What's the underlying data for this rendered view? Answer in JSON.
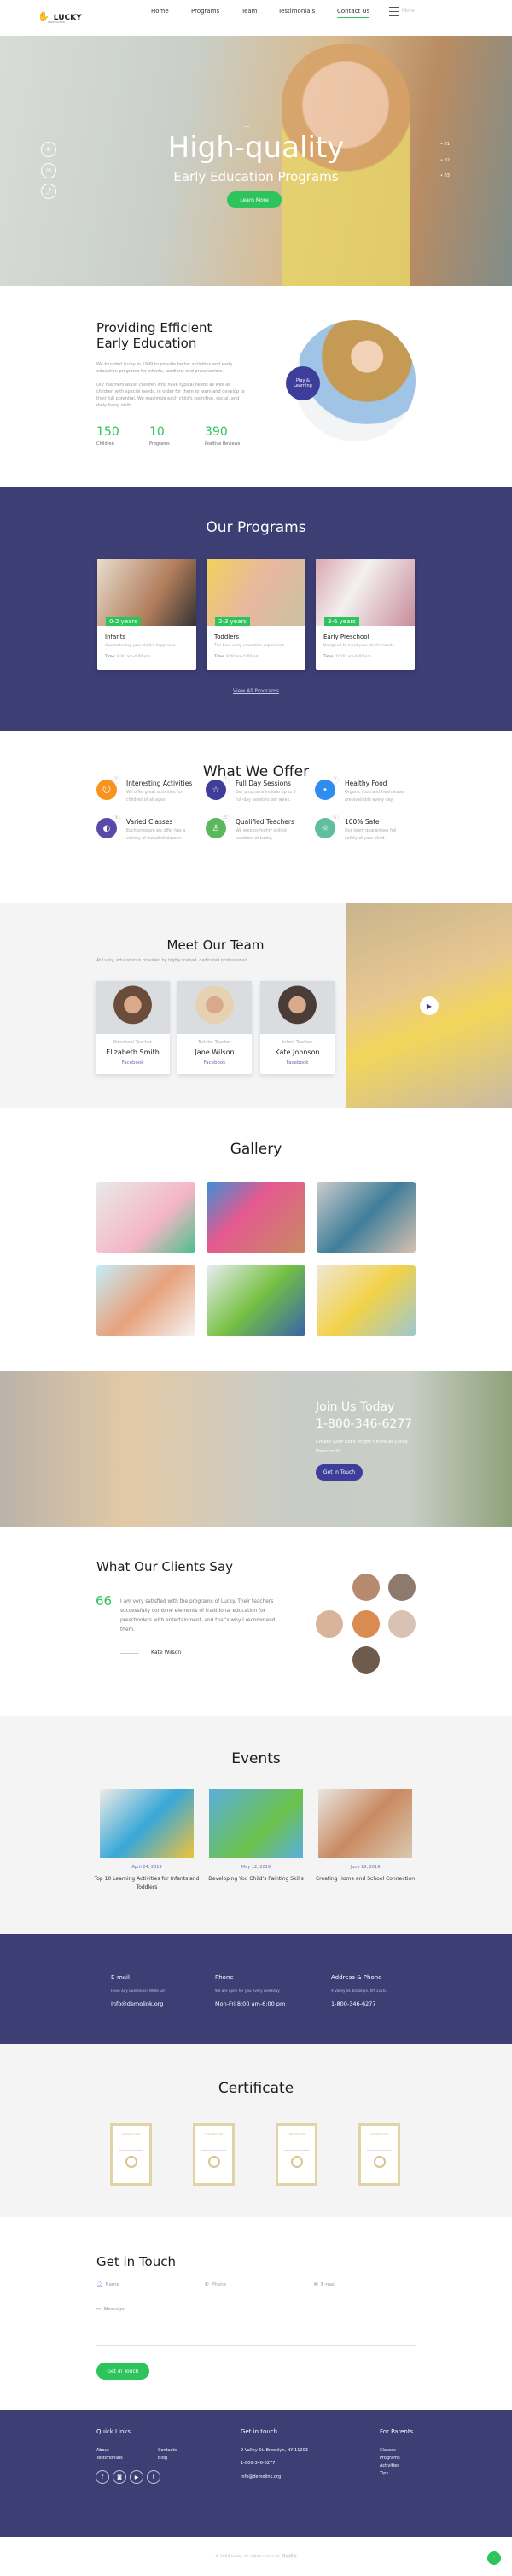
{
  "header": {
    "logo": "LUCKY",
    "logo_sub": "KINDERGARTEN",
    "nav": [
      "Home",
      "Programs",
      "Team",
      "Testimonials",
      "Contact Us"
    ],
    "active": "Contact Us",
    "more": "More"
  },
  "hero": {
    "title": "High-quality",
    "subtitle": "Early Education Programs",
    "button": "Learn More",
    "slides": [
      "01",
      "02",
      "03"
    ],
    "side_icons": [
      "phone-icon",
      "mail-icon",
      "share-icon"
    ]
  },
  "about": {
    "title_line1": "Providing Efficient",
    "title_line2": "Early Education",
    "p1": "We founded Lucky in 1999 to provide better activities and early education programs for infants, toddlers, and preschoolers.",
    "p2": "Our teachers assist children who have typical needs as well as children with special needs, in order for them to learn and develop to their full potential. We maximize each child's cognitive, social, and daily living skills.",
    "badge": "Play & Learning",
    "stats": [
      {
        "value": "150",
        "label": "Children"
      },
      {
        "value": "10",
        "label": "Programs"
      },
      {
        "value": "390",
        "label": "Positive Reviews"
      }
    ]
  },
  "programs": {
    "title": "Our Programs",
    "items": [
      {
        "age": "0-2 years",
        "name": "Infants",
        "desc": "Guaranteeing your child's happiness",
        "time_label": "Time:",
        "time": "8:00 am-4:00 pm"
      },
      {
        "age": "2-3 years",
        "name": "Toddlers",
        "desc": "The best early education experience",
        "time_label": "Time:",
        "time": "9:00 am-5:00 pm"
      },
      {
        "age": "3-6 years",
        "name": "Early Preschool",
        "desc": "Designed to meet your child's needs",
        "time_label": "Time:",
        "time": "10:00 am-6:00 pm"
      }
    ],
    "view_all": "View All Programs"
  },
  "offer": {
    "title": "What We Offer",
    "items": [
      {
        "n": "1",
        "title": "Interesting Activities",
        "desc": "We offer great activities for children of all ages.",
        "color": "#f7941d",
        "icon": "smile-icon"
      },
      {
        "n": "2",
        "title": "Full Day Sessions",
        "desc": "Our programs include up to 5 full-day sessions per week.",
        "color": "#3c3e9a",
        "icon": "star-icon"
      },
      {
        "n": "3",
        "title": "Healthy Food",
        "desc": "Organic food and fresh water are available every day.",
        "color": "#2f8cf0",
        "icon": "apple-icon"
      },
      {
        "n": "4",
        "title": "Varied Classes",
        "desc": "Each program we offer has a variety of included classes.",
        "color": "#5a4aa8",
        "icon": "palette-icon"
      },
      {
        "n": "5",
        "title": "Qualified Teachers",
        "desc": "We employ highly skilled teachers at Lucky.",
        "color": "#5cb85c",
        "icon": "teacher-icon"
      },
      {
        "n": "6",
        "title": "100% Safe",
        "desc": "Our team guarantees full safety of your child.",
        "color": "#5fbf9c",
        "icon": "sun-icon"
      }
    ]
  },
  "team": {
    "title": "Meet Our Team",
    "subtitle": "At Lucky, education is provided by highly trained, dedicated professionals.",
    "members": [
      {
        "role": "Preschool Teacher",
        "name": "Elizabeth Smith",
        "link": "Facebook"
      },
      {
        "role": "Toddler Teacher",
        "name": "Jane Wilson",
        "link": "Facebook"
      },
      {
        "role": "Infant Teacher",
        "name": "Kate Johnson",
        "link": "Facebook"
      }
    ]
  },
  "gallery": {
    "title": "Gallery"
  },
  "join": {
    "title": "Join Us Today",
    "phone": "1-800-346-6277",
    "text": "Create your kid's bright future at Lucky Preschool!",
    "button": "Get in Touch"
  },
  "testimonials": {
    "title": "What Our Clients Say",
    "quote_mark": "66",
    "quote": "I am very satisfied with the programs of Lucky. Their teachers successfully combine elements of traditional education for preschoolers with entertainment, and that's why I recommend them.",
    "author": "Kate Wilson"
  },
  "events": {
    "title": "Events",
    "items": [
      {
        "date": "April 24, 2019",
        "title": "Top 10 Learning Activities for Infants and Toddlers"
      },
      {
        "date": "May 12, 2019",
        "title": "Developing You Child's Painting Skills"
      },
      {
        "date": "June 19, 2019",
        "title": "Creating Home and School Connection"
      }
    ]
  },
  "contact_band": {
    "cols": [
      {
        "title": "E-mail",
        "sub": "Have any questions? Write us!",
        "value": "Info@demolink.org"
      },
      {
        "title": "Phone",
        "sub": "We are open for you every weekday",
        "value": "Mon-Fri 8:00 am-6:00 pm"
      },
      {
        "title": "Address & Phone",
        "sub": "9 Valley St. Brooklyn, NY 11203",
        "value": "1-800-346-6277"
      }
    ]
  },
  "certificate": {
    "title": "Certificate",
    "label": "CERTIFICATE"
  },
  "form": {
    "title": "Get in Touch",
    "name_ph": "Name",
    "phone_ph": "Phone",
    "email_ph": "E-mail",
    "message_ph": "Message",
    "button": "Get in Touch"
  },
  "footer": {
    "quick_title": "Quick Links",
    "quick": [
      "About",
      "Contacts",
      "Testimonials",
      "Blog"
    ],
    "touch_title": "Get in touch",
    "address": "9 Valley St. Brooklyn, NY 11203",
    "phone": "1-800-346-6277",
    "email": "info@demolink.org",
    "parents_title": "For Parents",
    "parents": [
      "Classes",
      "Programs",
      "Activities",
      "Tips"
    ],
    "social": [
      "facebook-icon",
      "instagram-icon",
      "youtube-icon",
      "twitter-icon"
    ],
    "copyright": "© 2024 Lucky. All rights reserved. 网站模板"
  },
  "colors": {
    "purple": "#3c3e74",
    "green": "#2ec45c",
    "accent_text": "#6a6cb3"
  }
}
